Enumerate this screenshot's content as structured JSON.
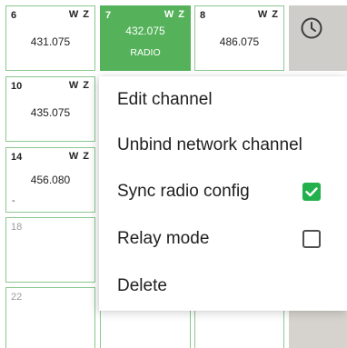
{
  "grid": {
    "cells": [
      {
        "number": "6",
        "wz": "W Z",
        "freq": "431.075",
        "sub": "",
        "dash": ""
      },
      {
        "number": "7",
        "wz": "W Z",
        "freq": "432.075",
        "sub": "RADIO",
        "dash": ""
      },
      {
        "number": "8",
        "wz": "W Z",
        "freq": "486.075",
        "sub": "",
        "dash": ""
      },
      {
        "number": "10",
        "wz": "W Z",
        "freq": "435.075",
        "sub": "",
        "dash": ""
      },
      {
        "number": "14",
        "wz": "W Z",
        "freq": "456.080",
        "sub": "",
        "dash": "-"
      },
      {
        "number": "18",
        "wz": "",
        "freq": "",
        "sub": "",
        "dash": ""
      },
      {
        "number": "22",
        "wz": "",
        "freq": "",
        "sub": "",
        "dash": ""
      }
    ],
    "active_color": "#55b25a",
    "border_color": "#8cc78f"
  },
  "side_panel": {
    "icon": "clock-icon"
  },
  "context_menu": {
    "items": [
      {
        "label": "Edit channel"
      },
      {
        "label": "Unbind network channel"
      },
      {
        "label": "Sync radio config",
        "checked": true
      },
      {
        "label": "Relay mode",
        "checked": false
      },
      {
        "label": "Delete"
      }
    ],
    "check_color": "#21b04b"
  }
}
